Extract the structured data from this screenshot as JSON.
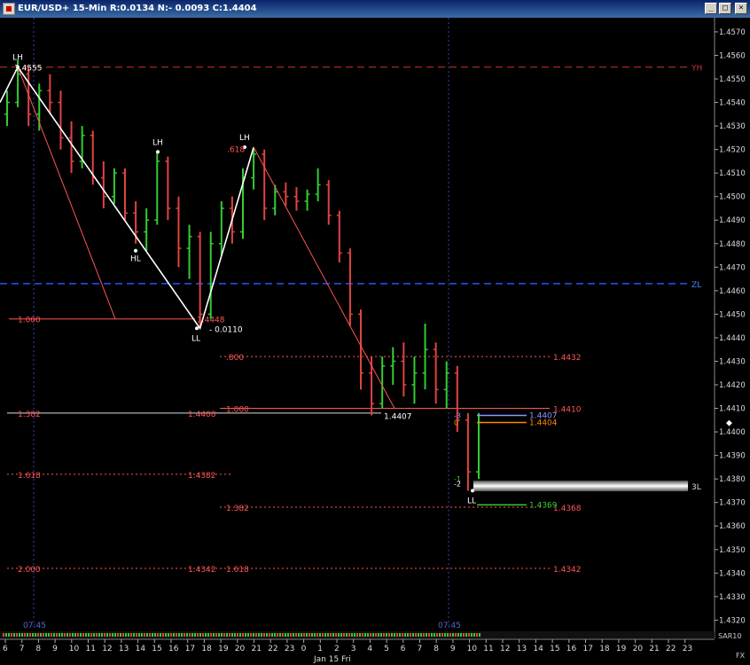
{
  "window": {
    "title": "EUR/USD+ 15-Min R:0.0134 N:- 0.0093 C:1.4404",
    "buttons": {
      "minimize": "_",
      "maximize": "□",
      "close": "×"
    }
  },
  "colors": {
    "background": "#000000",
    "up_bar": "#33cc33",
    "down_bar": "#e0443e",
    "fib_line": "#ff5555",
    "grid": "#3344aa",
    "white": "#ffffff",
    "zl_line": "#2255ff",
    "yh_line": "#cc3333"
  },
  "price_axis": {
    "labels": [
      "1.4570",
      "1.4560",
      "1.4550",
      "1.4540",
      "1.4530",
      "1.4520",
      "1.4510",
      "1.4500",
      "1.4490",
      "1.4480",
      "1.4470",
      "1.4460",
      "1.4450",
      "1.4440",
      "1.4430",
      "1.4420",
      "1.4410",
      "1.4400",
      "1.4390",
      "1.4380",
      "1.4370",
      "1.4360",
      "1.4350",
      "1.4340",
      "1.4330",
      "1.4320"
    ]
  },
  "time_axis": {
    "ticks": [
      "6",
      "7",
      "8",
      "9",
      "10",
      "11",
      "12",
      "13",
      "14",
      "15",
      "16",
      "17",
      "18",
      "19",
      "20",
      "21",
      "22",
      "23",
      "0",
      "1",
      "2",
      "3",
      "4",
      "5",
      "6",
      "7",
      "8",
      "9",
      "10",
      "11",
      "12",
      "13",
      "14",
      "15",
      "16",
      "17",
      "18",
      "19",
      "20",
      "21",
      "22",
      "23"
    ],
    "date_label": "Jan 15 Fri",
    "vline_labels": [
      "07:45",
      "07:45"
    ],
    "fx_label": "FX",
    "sar_label": "SAR10"
  },
  "reference_lines": {
    "yh": {
      "label": "YH",
      "price": 1.4555
    },
    "zl": {
      "label": "ZL",
      "price": 1.4463
    },
    "three_l": {
      "label": "3L",
      "price": 1.4377
    }
  },
  "annotations": {
    "swings": [
      {
        "label": "LH",
        "price": 1.4555
      },
      {
        "label": "LH",
        "price": 1.4519
      },
      {
        "label": "HL",
        "price": 1.4477
      },
      {
        "label": "LH",
        "price": 1.4521
      },
      {
        "label": "LL",
        "price": 1.4444
      },
      {
        "label": "LL",
        "price": 1.4375
      }
    ],
    "texts": {
      "high_value": "1.4555",
      "range_value": "0.0110",
      "close_value": "1.4407",
      "fib618": ".618",
      "fib_left_label": "1.4448"
    }
  },
  "fib_levels_left": [
    {
      "ratio": "1.000",
      "price": "1.4448"
    },
    {
      "ratio": "1.382",
      "price": "1.4408"
    },
    {
      "ratio": "1.618",
      "price": "1.4382"
    },
    {
      "ratio": "2.000",
      "price": "1.4342"
    }
  ],
  "fib_levels_right": [
    {
      "ratio": ".800",
      "price": "1.4432"
    },
    {
      "ratio": "1.000",
      "price": "1.4410"
    },
    {
      "ratio": "1.382",
      "price": "1.4368"
    },
    {
      "ratio": "1.618",
      "price": "1.4342"
    }
  ],
  "projections": [
    {
      "label": "-3",
      "price": "1.4407",
      "color": "#8899ff"
    },
    {
      "label": "0",
      "price": "1.4404",
      "color": "#ff8800"
    },
    {
      "label": "-1",
      "price": "",
      "color": "#33cc33"
    },
    {
      "label": "-2",
      "price": "",
      "color": "#ffffff"
    },
    {
      "label": "",
      "price": "1.4369",
      "color": "#33cc33"
    }
  ],
  "chart_data": {
    "type": "ohlc",
    "title": "EUR/USD+ 15-Min",
    "ylim": [
      1.4316,
      1.4576
    ],
    "bars": [
      {
        "o": 1.4535,
        "h": 1.4545,
        "l": 1.453,
        "c": 1.454
      },
      {
        "o": 1.454,
        "h": 1.4558,
        "l": 1.4538,
        "c": 1.4552
      },
      {
        "o": 1.4552,
        "h": 1.4555,
        "l": 1.453,
        "c": 1.4535
      },
      {
        "o": 1.4535,
        "h": 1.4548,
        "l": 1.4528,
        "c": 1.4545
      },
      {
        "o": 1.4545,
        "h": 1.4552,
        "l": 1.4535,
        "c": 1.454
      },
      {
        "o": 1.454,
        "h": 1.4545,
        "l": 1.452,
        "c": 1.4525
      },
      {
        "o": 1.4525,
        "h": 1.4532,
        "l": 1.451,
        "c": 1.4515
      },
      {
        "o": 1.4515,
        "h": 1.453,
        "l": 1.4512,
        "c": 1.4526
      },
      {
        "o": 1.4526,
        "h": 1.4528,
        "l": 1.4505,
        "c": 1.4508
      },
      {
        "o": 1.4508,
        "h": 1.4515,
        "l": 1.4495,
        "c": 1.45
      },
      {
        "o": 1.45,
        "h": 1.4512,
        "l": 1.4497,
        "c": 1.451
      },
      {
        "o": 1.451,
        "h": 1.4512,
        "l": 1.449,
        "c": 1.4493
      },
      {
        "o": 1.4493,
        "h": 1.4498,
        "l": 1.448,
        "c": 1.4485
      },
      {
        "o": 1.4485,
        "h": 1.4495,
        "l": 1.4477,
        "c": 1.449
      },
      {
        "o": 1.449,
        "h": 1.4519,
        "l": 1.4488,
        "c": 1.4515
      },
      {
        "o": 1.4515,
        "h": 1.4517,
        "l": 1.449,
        "c": 1.4495
      },
      {
        "o": 1.4495,
        "h": 1.45,
        "l": 1.447,
        "c": 1.4478
      },
      {
        "o": 1.4478,
        "h": 1.4488,
        "l": 1.4465,
        "c": 1.4483
      },
      {
        "o": 1.4483,
        "h": 1.4485,
        "l": 1.4444,
        "c": 1.445
      },
      {
        "o": 1.445,
        "h": 1.4485,
        "l": 1.4448,
        "c": 1.448
      },
      {
        "o": 1.448,
        "h": 1.4498,
        "l": 1.4475,
        "c": 1.4495
      },
      {
        "o": 1.4495,
        "h": 1.45,
        "l": 1.448,
        "c": 1.4485
      },
      {
        "o": 1.4485,
        "h": 1.4512,
        "l": 1.4482,
        "c": 1.4508
      },
      {
        "o": 1.4508,
        "h": 1.4521,
        "l": 1.4503,
        "c": 1.4518
      },
      {
        "o": 1.4518,
        "h": 1.452,
        "l": 1.449,
        "c": 1.4495
      },
      {
        "o": 1.4495,
        "h": 1.4505,
        "l": 1.4492,
        "c": 1.4502
      },
      {
        "o": 1.4502,
        "h": 1.4506,
        "l": 1.4496,
        "c": 1.45
      },
      {
        "o": 1.45,
        "h": 1.4504,
        "l": 1.4494,
        "c": 1.4498
      },
      {
        "o": 1.4498,
        "h": 1.4503,
        "l": 1.4494,
        "c": 1.4501
      },
      {
        "o": 1.4501,
        "h": 1.4512,
        "l": 1.4498,
        "c": 1.4505
      },
      {
        "o": 1.4505,
        "h": 1.4507,
        "l": 1.4488,
        "c": 1.4492
      },
      {
        "o": 1.4492,
        "h": 1.4494,
        "l": 1.4472,
        "c": 1.4476
      },
      {
        "o": 1.4476,
        "h": 1.4478,
        "l": 1.4445,
        "c": 1.445
      },
      {
        "o": 1.445,
        "h": 1.4452,
        "l": 1.4418,
        "c": 1.4425
      },
      {
        "o": 1.4425,
        "h": 1.4432,
        "l": 1.4407,
        "c": 1.4412
      },
      {
        "o": 1.4412,
        "h": 1.4432,
        "l": 1.441,
        "c": 1.4428
      },
      {
        "o": 1.4428,
        "h": 1.4436,
        "l": 1.442,
        "c": 1.443
      },
      {
        "o": 1.443,
        "h": 1.4438,
        "l": 1.4415,
        "c": 1.442
      },
      {
        "o": 1.442,
        "h": 1.4432,
        "l": 1.4412,
        "c": 1.4425
      },
      {
        "o": 1.4425,
        "h": 1.4446,
        "l": 1.4418,
        "c": 1.4435
      },
      {
        "o": 1.4435,
        "h": 1.4438,
        "l": 1.4412,
        "c": 1.4418
      },
      {
        "o": 1.4418,
        "h": 1.443,
        "l": 1.441,
        "c": 1.4425
      },
      {
        "o": 1.4425,
        "h": 1.4428,
        "l": 1.44,
        "c": 1.4405
      },
      {
        "o": 1.4405,
        "h": 1.4408,
        "l": 1.4375,
        "c": 1.4383
      },
      {
        "o": 1.4383,
        "h": 1.4408,
        "l": 1.438,
        "c": 1.4404
      }
    ]
  }
}
